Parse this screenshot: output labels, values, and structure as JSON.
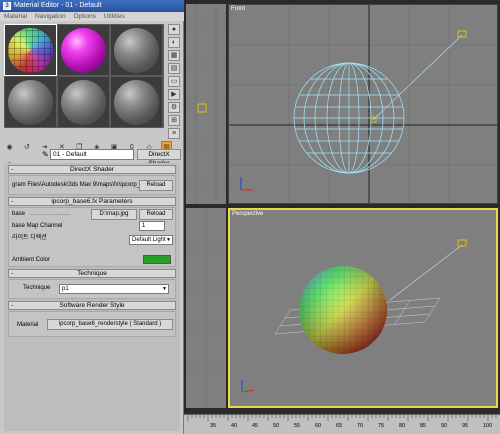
{
  "window": {
    "title": "Material Editor - 01 - Default"
  },
  "menu": [
    "Material",
    "Navigation",
    "Options",
    "Utilities"
  ],
  "slots": [
    {
      "kind": "rainbow"
    },
    {
      "kind": "magenta"
    },
    {
      "kind": "grey"
    },
    {
      "kind": "grey"
    },
    {
      "kind": "grey"
    },
    {
      "kind": "grey"
    }
  ],
  "material_row": {
    "name": "01 - Default",
    "type": "DirectX Shader"
  },
  "directx": {
    "header": "DirectX Shader",
    "path": "gram Files\\Autodesk\\3ds Max 9\\maps\\fx\\ipcorp_ba",
    "reload": "Reload"
  },
  "params": {
    "header": "ipcorp_base6.fx Parameters",
    "base_label": "base",
    "base_value": "D:\\map.jpg",
    "base_reload": "Reload",
    "channel_label": "base Map Channel",
    "channel_value": "1",
    "light_label": "라이트 디렉션",
    "light_value": "Default Light",
    "ambient_label": "Ambient Color",
    "ambient_color": "#28a028"
  },
  "technique": {
    "header": "Technique",
    "label": "Technique",
    "value": "p1"
  },
  "software": {
    "header": "Software Render Style",
    "label": "Material",
    "value": "ipcorp_base6_renderstyle  ( Standard )"
  },
  "viewports": {
    "front_label": "Front",
    "perspective_label": "Perspective"
  },
  "timeline": {
    "ticks": [
      "35",
      "40",
      "45",
      "50",
      "55",
      "60",
      "65",
      "70",
      "75",
      "80",
      "85",
      "90",
      "95",
      "100"
    ]
  }
}
